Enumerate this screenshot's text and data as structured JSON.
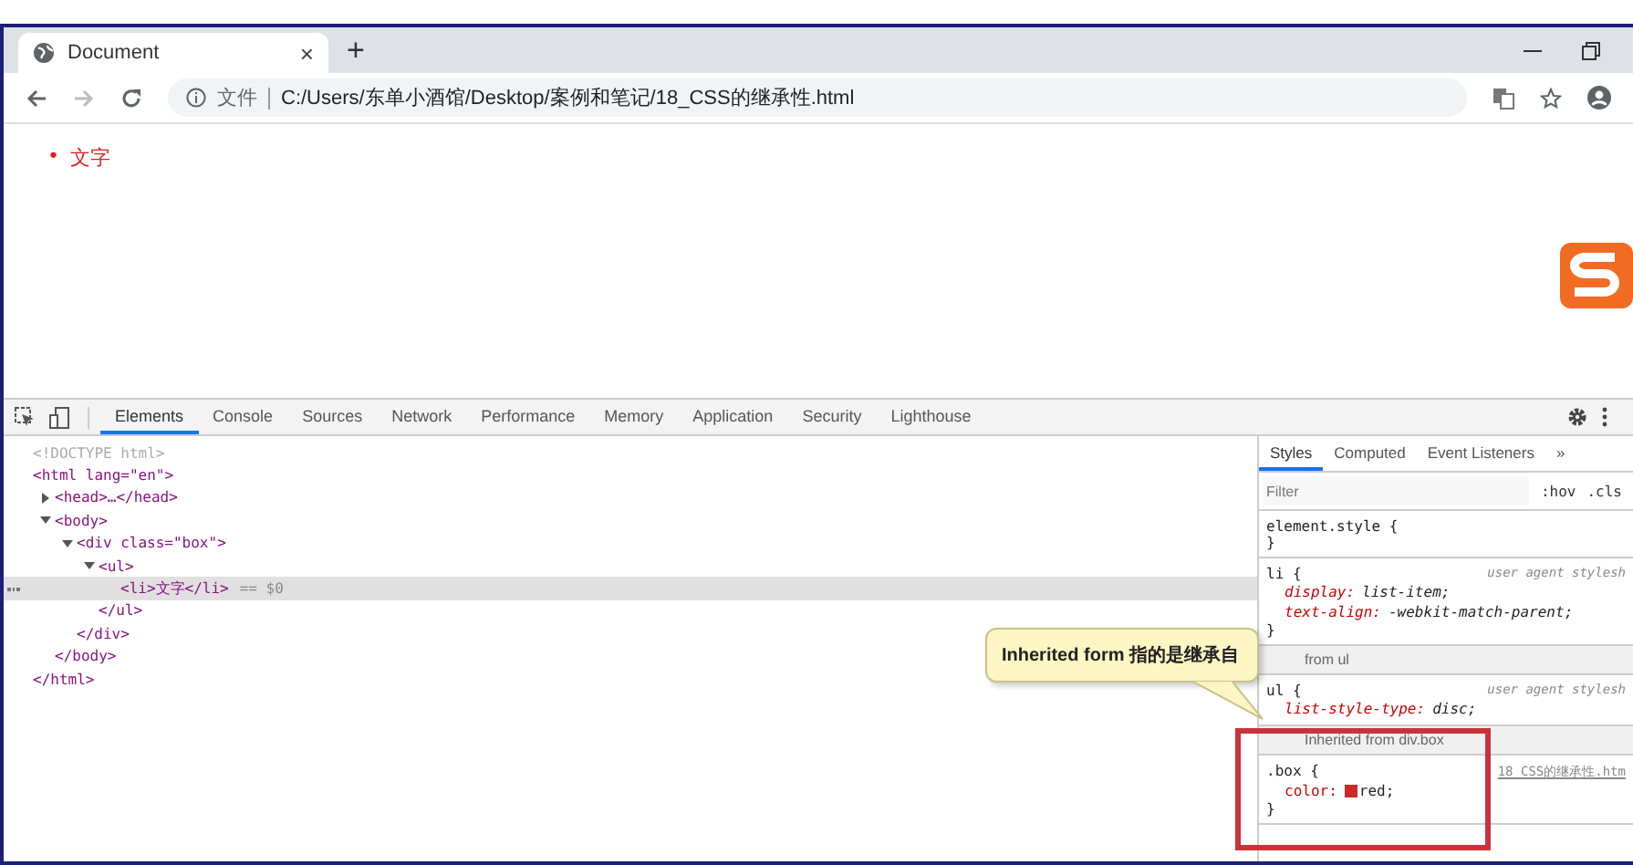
{
  "browser_tab": {
    "title": "Document",
    "close": "×"
  },
  "new_tab": "+",
  "address": {
    "security_label": "文件",
    "url": "C:/Users/东单小酒馆/Desktop/案例和笔记/18_CSS的继承性.html"
  },
  "page": {
    "list_items": [
      {
        "marker": "•",
        "text": "文字"
      }
    ]
  },
  "devtools": {
    "tabs": [
      {
        "label": "Elements",
        "selected": true
      },
      {
        "label": "Console",
        "selected": false
      },
      {
        "label": "Sources",
        "selected": false
      },
      {
        "label": "Network",
        "selected": false
      },
      {
        "label": "Performance",
        "selected": false
      },
      {
        "label": "Memory",
        "selected": false
      },
      {
        "label": "Application",
        "selected": false
      },
      {
        "label": "Security",
        "selected": false
      },
      {
        "label": "Lighthouse",
        "selected": false
      }
    ],
    "dom": [
      {
        "kind": "doctype",
        "line": "<!DOCTYPE html>",
        "selected": false
      },
      {
        "kind": "element",
        "line": "<html lang=\"en\">",
        "close": "</html>",
        "selected": false,
        "children": [
          {
            "kind": "element",
            "line": "<head>…</head>",
            "expanded": false,
            "selected": false
          },
          {
            "kind": "element",
            "line": "<body>",
            "expanded": true,
            "close": "</body>",
            "selected": false,
            "children": [
              {
                "kind": "element",
                "line": "<div class=\"box\">",
                "expanded": true,
                "close": "</div>",
                "selected": false,
                "children": [
                  {
                    "kind": "element",
                    "line": "<ul>",
                    "expanded": true,
                    "close": "</ul>",
                    "selected": false,
                    "children": [
                      {
                        "kind": "element",
                        "line": "<li>文字</li>",
                        "suffix": "== $0",
                        "selected": true
                      }
                    ]
                  }
                ]
              }
            ]
          }
        ]
      }
    ],
    "styles_tabs": [
      {
        "label": "Styles",
        "selected": true
      },
      {
        "label": "Computed",
        "selected": false
      },
      {
        "label": "Event Listeners",
        "selected": false
      }
    ],
    "styles_more": "»",
    "filter": {
      "placeholder": "Filter",
      "buttons": [
        ":hov",
        ".cls"
      ]
    },
    "sections": [
      {
        "selector": "element.style {",
        "close": "}"
      },
      {
        "selector": "li {",
        "source": "user agent stylesh",
        "close": "}",
        "declarations": [
          {
            "property": "display:",
            "value": "list-item;"
          },
          {
            "property": "text-align:",
            "value": "-webkit-match-parent;"
          }
        ]
      },
      {
        "header": "from ul",
        "selector": "ul {",
        "source": "user agent stylesh",
        "declarations": [
          {
            "property": "list-style-type:",
            "value": "disc;"
          }
        ]
      },
      {
        "header": "Inherited from div.box",
        "selector": ".box {",
        "source": "18_CSS的继承性.htm",
        "close": "}",
        "declarations": [
          {
            "property": "color:",
            "value": "red;",
            "color": "#cc2a2a"
          }
        ]
      }
    ],
    "callout": "Inherited form 指的是继承自"
  }
}
